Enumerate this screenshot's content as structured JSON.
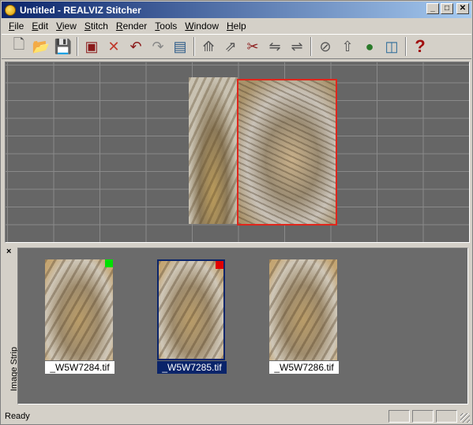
{
  "window": {
    "title": "Untitled - REALVIZ Stitcher"
  },
  "menu": [
    "File",
    "Edit",
    "View",
    "Stitch",
    "Render",
    "Tools",
    "Window",
    "Help"
  ],
  "toolbar": [
    {
      "icon": "new-file-icon",
      "glyph": "🗋"
    },
    {
      "icon": "open-folder-icon",
      "glyph": "📂"
    },
    {
      "icon": "save-icon",
      "glyph": "💾"
    },
    {
      "icon": "import-image-icon",
      "glyph": "▣"
    },
    {
      "icon": "delete-icon",
      "glyph": "✕"
    },
    {
      "icon": "undo-icon",
      "glyph": "↶"
    },
    {
      "icon": "redo-icon",
      "glyph": "↷"
    },
    {
      "icon": "preview-icon",
      "glyph": "▤"
    },
    {
      "icon": "stitch-icon",
      "glyph": "⟰"
    },
    {
      "icon": "point-match-icon",
      "glyph": "⇗"
    },
    {
      "icon": "unstitch-icon",
      "glyph": "✂"
    },
    {
      "icon": "align-icon",
      "glyph": "⇋"
    },
    {
      "icon": "align-all-icon",
      "glyph": "⇌"
    },
    {
      "icon": "equalize-icon",
      "glyph": "⊘"
    },
    {
      "icon": "horizon-icon",
      "glyph": "⇧"
    },
    {
      "icon": "color-balance-icon",
      "glyph": "●"
    },
    {
      "icon": "render-icon",
      "glyph": "◫"
    },
    {
      "icon": "help-icon",
      "glyph": "?"
    }
  ],
  "image_strip": {
    "label": "Image Strip",
    "items": [
      {
        "filename": "_W5W7284.tif",
        "marker": "#00e000",
        "selected": false
      },
      {
        "filename": "_W5W7285.tif",
        "marker": "#e00000",
        "selected": true
      },
      {
        "filename": "_W5W7286.tif",
        "marker": "",
        "selected": false
      }
    ]
  },
  "status": {
    "text": "Ready"
  },
  "colors": {
    "selection": "#0a246a",
    "stitch_outline": "#e0261c"
  }
}
